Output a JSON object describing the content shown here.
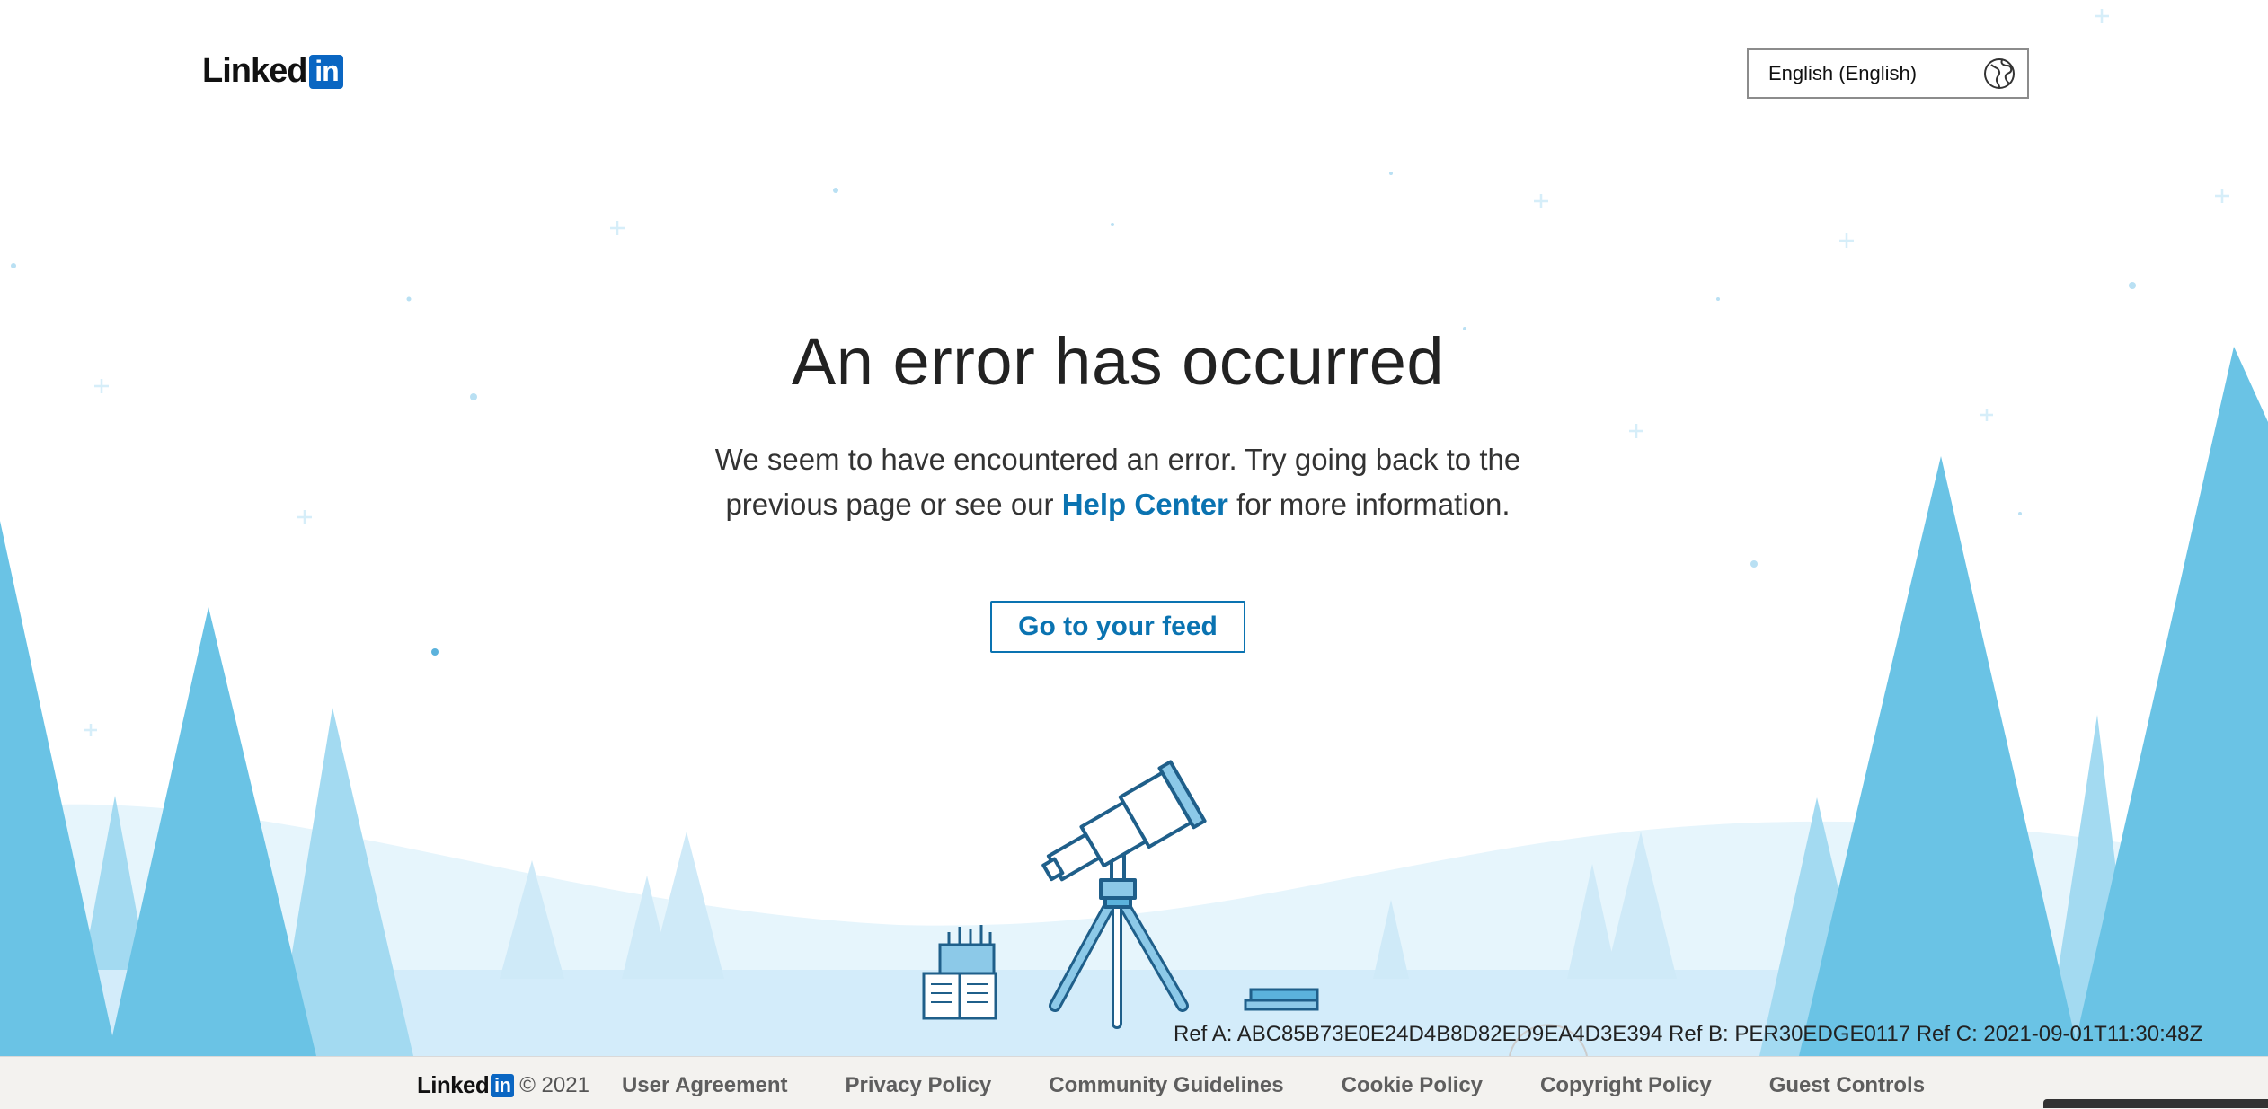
{
  "header": {
    "logo_text": "Linked",
    "logo_in": "in",
    "language_label": "English (English)",
    "language_icon": "globe-icon"
  },
  "main": {
    "title": "An error has occurred",
    "message_part1": "We seem to have encountered an error. Try going back to the previous page or see our",
    "help_link": "Help Center",
    "message_part2": "for more information.",
    "button_label": "Go to your feed"
  },
  "refs": "Ref A: ABC85B73E0E24D4B8D82ED9EA4D3E394 Ref B: PER30EDGE0117 Ref C: 2021-09-01T11:30:48Z",
  "footer": {
    "logo_text": "Linked",
    "logo_in": "in",
    "copyright": "© 2021",
    "links": [
      "User Agreement",
      "Privacy Policy",
      "Community Guidelines",
      "Cookie Policy",
      "Copyright Policy",
      "Guest Controls"
    ]
  },
  "colors": {
    "brand_blue": "#0a66c2",
    "link_blue": "#0a73b1",
    "tree_dark": "#6ac3e5",
    "tree_light": "#a3daf1",
    "tree_pale": "#cfeaf8",
    "ground": "#d3ecfa"
  },
  "illustration": [
    "telescope-illustration",
    "book-illustration",
    "trees-illustration"
  ]
}
